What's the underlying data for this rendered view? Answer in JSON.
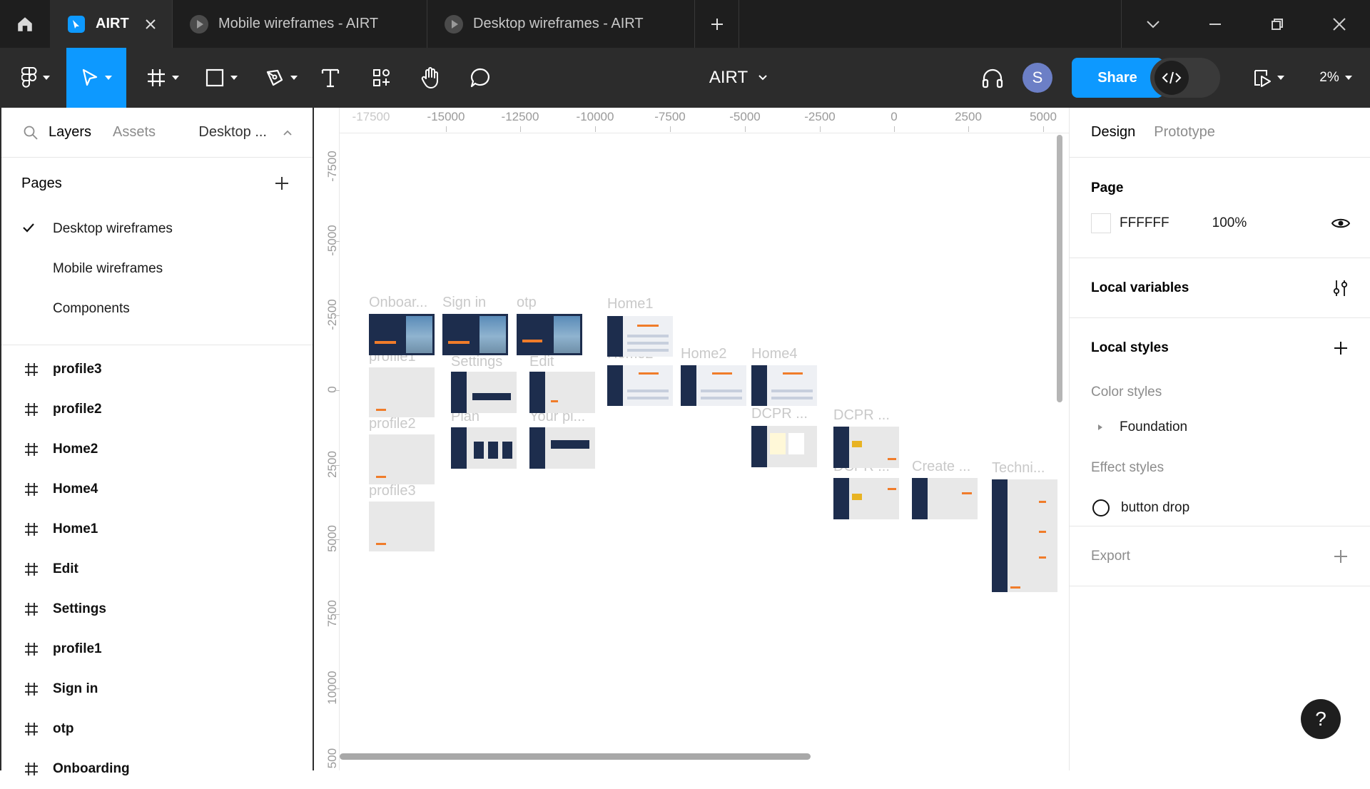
{
  "titlebar": {
    "tabs": [
      {
        "label": "AIRT"
      },
      {
        "label": "Mobile wireframes - AIRT"
      },
      {
        "label": "Desktop wireframes - AIRT"
      }
    ]
  },
  "toolbar": {
    "file_title": "AIRT",
    "avatar_initial": "S",
    "share_label": "Share",
    "zoom": "2%"
  },
  "left_panel": {
    "tabs": {
      "layers": "Layers",
      "assets": "Assets",
      "page_selector": "Desktop ..."
    },
    "pages_heading": "Pages",
    "pages": [
      {
        "label": "Desktop wireframes",
        "selected": true
      },
      {
        "label": "Mobile wireframes",
        "selected": false
      },
      {
        "label": "Components",
        "selected": false
      }
    ],
    "layers": [
      {
        "label": "profile3"
      },
      {
        "label": "profile2"
      },
      {
        "label": "Home2"
      },
      {
        "label": "Home4"
      },
      {
        "label": "Home1"
      },
      {
        "label": "Edit"
      },
      {
        "label": "Settings"
      },
      {
        "label": "profile1"
      },
      {
        "label": "Sign in"
      },
      {
        "label": "otp"
      },
      {
        "label": "Onboarding"
      }
    ]
  },
  "canvas": {
    "h_ruler": [
      "-17500",
      "-15000",
      "-12500",
      "-10000",
      "-7500",
      "-5000",
      "-2500",
      "0",
      "2500",
      "5000"
    ],
    "v_ruler": [
      "-7500",
      "-5000",
      "-2500",
      "0",
      "2500",
      "5000",
      "7500",
      "10000",
      "500"
    ],
    "frames": [
      {
        "label": "Onboar..."
      },
      {
        "label": "Sign in"
      },
      {
        "label": "otp"
      },
      {
        "label": "Home1"
      },
      {
        "label": "profile1"
      },
      {
        "label": "Settings"
      },
      {
        "label": "Edit"
      },
      {
        "label": "Home2"
      },
      {
        "label": "Home2"
      },
      {
        "label": "Home4"
      },
      {
        "label": "profile2"
      },
      {
        "label": "Plan"
      },
      {
        "label": "Your pl..."
      },
      {
        "label": "DCPR ..."
      },
      {
        "label": "DCPR ..."
      },
      {
        "label": "DCPR ..."
      },
      {
        "label": "Create ..."
      },
      {
        "label": "Techni..."
      },
      {
        "label": "profile3"
      }
    ]
  },
  "right_panel": {
    "tabs": {
      "design": "Design",
      "prototype": "Prototype"
    },
    "page": {
      "title": "Page",
      "color": "FFFFFF",
      "opacity": "100%"
    },
    "local_variables": "Local variables",
    "local_styles": {
      "title": "Local styles",
      "color_styles": "Color styles",
      "foundation": "Foundation",
      "effect_styles": "Effect styles",
      "button_drop": "button drop"
    },
    "export": "Export"
  },
  "help_label": "?",
  "colors": {
    "accent": "#0d99ff",
    "frame_dark": "#1d2d4d",
    "orange": "#f07c2a"
  }
}
